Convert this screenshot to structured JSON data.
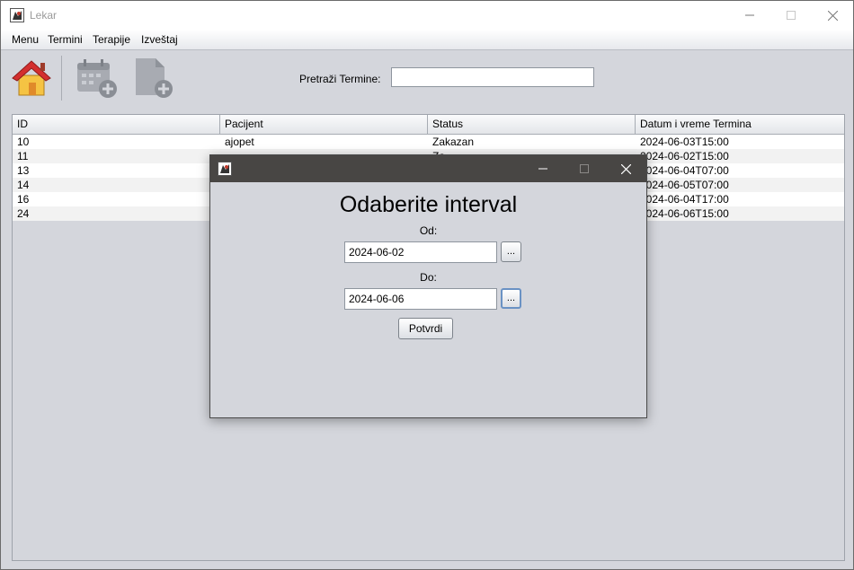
{
  "window": {
    "title": "Lekar"
  },
  "menu": [
    "Menu",
    "Termini",
    "Terapije",
    "Izveštaj"
  ],
  "toolbar": {
    "icons": [
      "home-icon",
      "calendar-add-icon",
      "document-add-icon"
    ],
    "search_label": "Pretraži Termine:",
    "search_value": ""
  },
  "table": {
    "columns": [
      "ID",
      "Pacijent",
      "Status",
      "Datum i vreme Termina"
    ],
    "rows": [
      [
        "10",
        "ajopet",
        "Zakazan",
        "2024-06-03T15:00"
      ],
      [
        "11",
        "",
        "Za",
        "2024-06-02T15:00"
      ],
      [
        "13",
        "",
        "",
        "2024-06-04T07:00"
      ],
      [
        "14",
        "",
        "",
        "2024-06-05T07:00"
      ],
      [
        "16",
        "",
        "",
        "2024-06-04T17:00"
      ],
      [
        "24",
        "",
        "",
        "2024-06-06T15:00"
      ]
    ]
  },
  "dialog": {
    "heading": "Odaberite interval",
    "from_label": "Od:",
    "from_value": "2024-06-02",
    "to_label": "Do:",
    "to_value": "2024-06-06",
    "picker_label": "...",
    "confirm_label": "Potvrdi"
  }
}
